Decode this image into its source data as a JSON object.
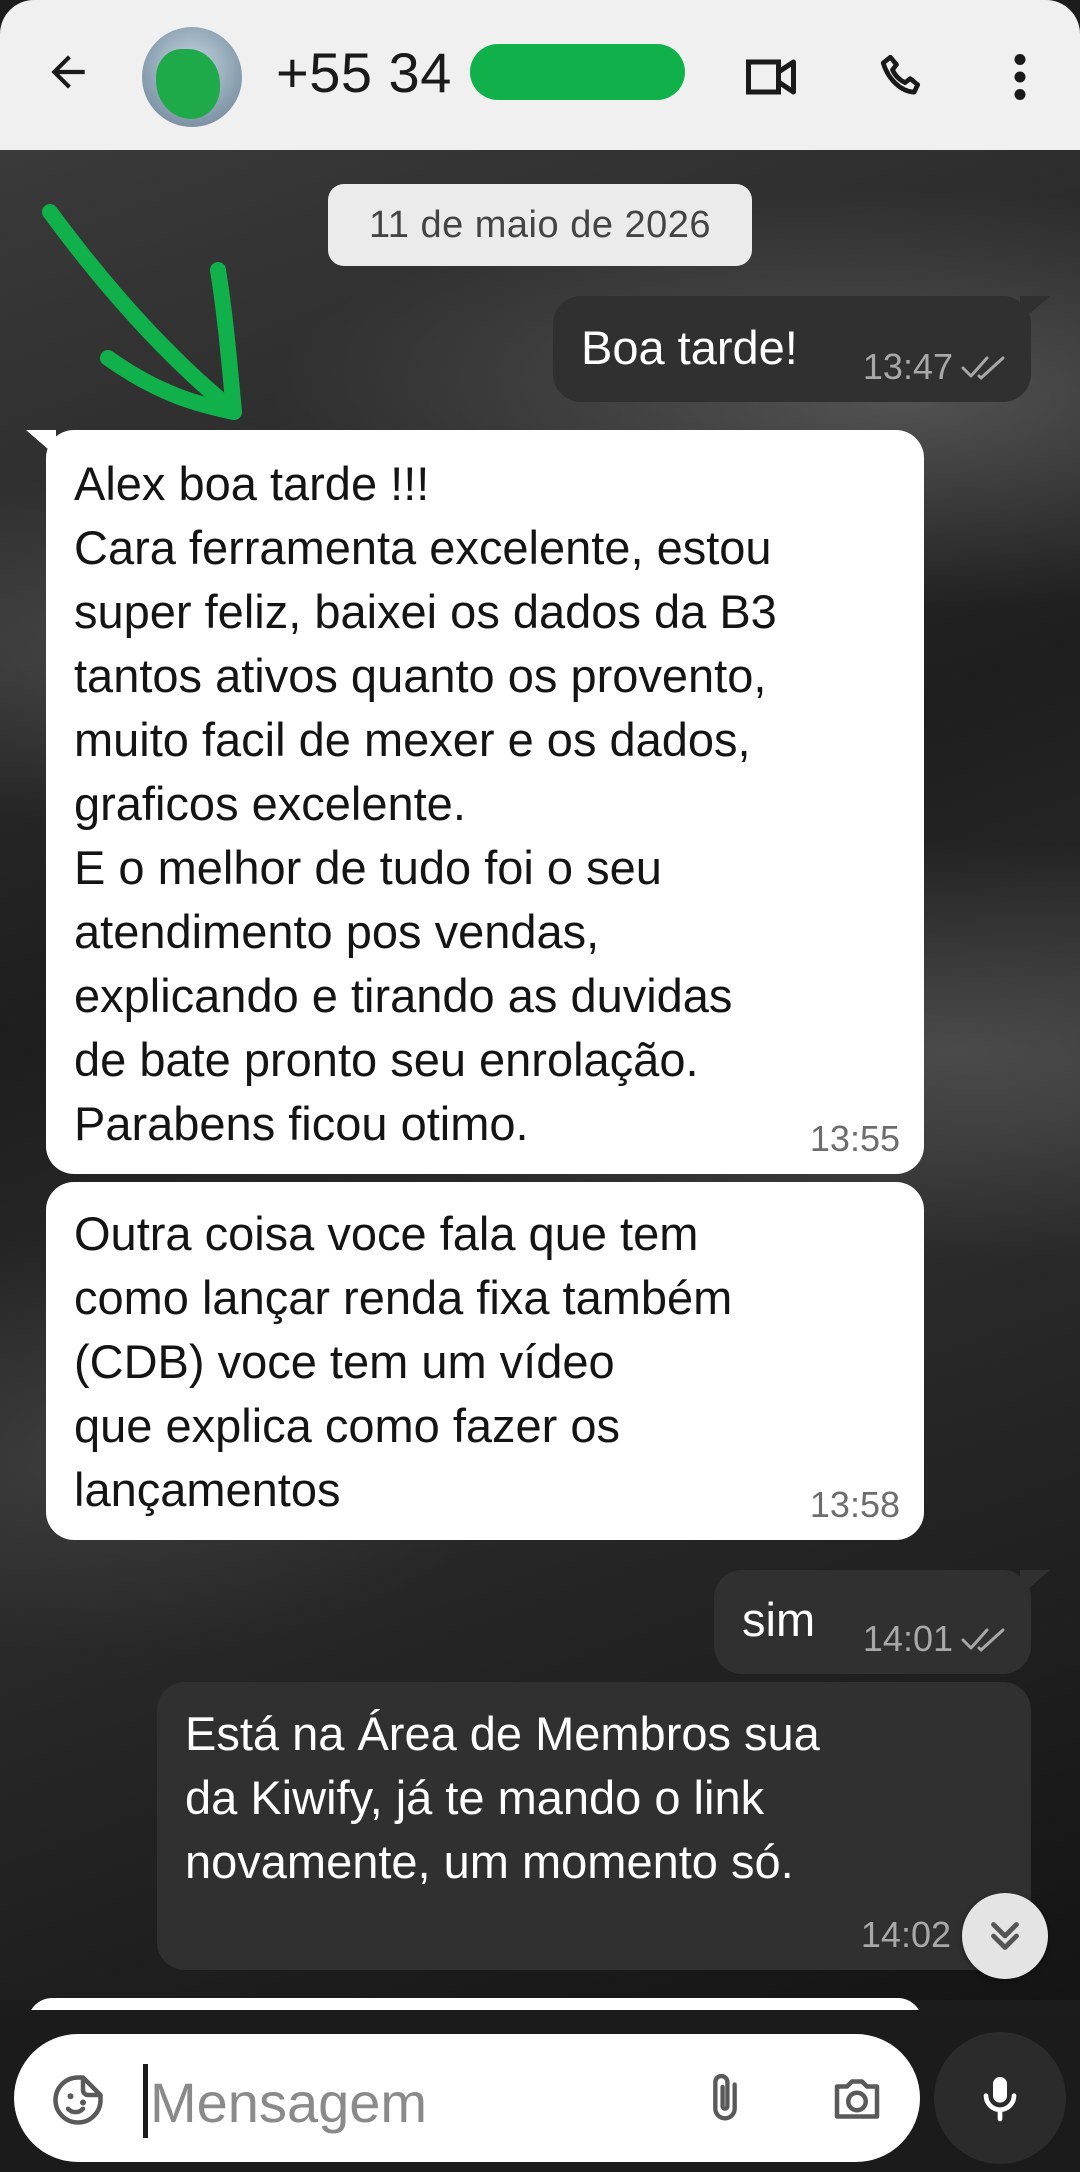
{
  "header": {
    "contact_name": "+55 34",
    "icons": {
      "back": "arrow-left-icon",
      "video": "video-camera-icon",
      "call": "phone-icon",
      "more": "more-vertical-icon"
    }
  },
  "chat": {
    "date_label": "11 de maio de 2026",
    "messages": [
      {
        "direction": "out",
        "text": "Boa tarde!",
        "time": "13:47",
        "status": "read"
      },
      {
        "direction": "in",
        "text": "Alex boa tarde !!!\nCara ferramenta excelente, estou\nsuper feliz, baixei os dados da B3\ntantos ativos quanto os provento,\nmuito facil de mexer e os dados,\ngraficos excelente.\nE o melhor de tudo foi o seu\natendimento pos vendas,\nexplicando e tirando as duvidas\nde bate pronto seu enrolação.\nParabens ficou otimo.",
        "time": "13:55"
      },
      {
        "direction": "in",
        "text": "Outra coisa voce fala que tem\ncomo lançar  renda fixa  também\n(CDB) voce tem um vídeo\nque explica  como fazer os\nlançamentos",
        "time": "13:58"
      },
      {
        "direction": "out",
        "text": "sim",
        "time": "14:01",
        "status": "read"
      },
      {
        "direction": "out",
        "text": "Está na Área de Membros sua\nda Kiwify, já te mando o link\nnovamente, um momento só.",
        "time": "14:02",
        "status": "read"
      }
    ],
    "annotation_color": "#10b04b"
  },
  "composer": {
    "placeholder": "Mensagem",
    "icons": {
      "emoji": "sticker-smile-icon",
      "attach": "paperclip-icon",
      "camera": "camera-icon",
      "mic": "microphone-icon"
    }
  }
}
